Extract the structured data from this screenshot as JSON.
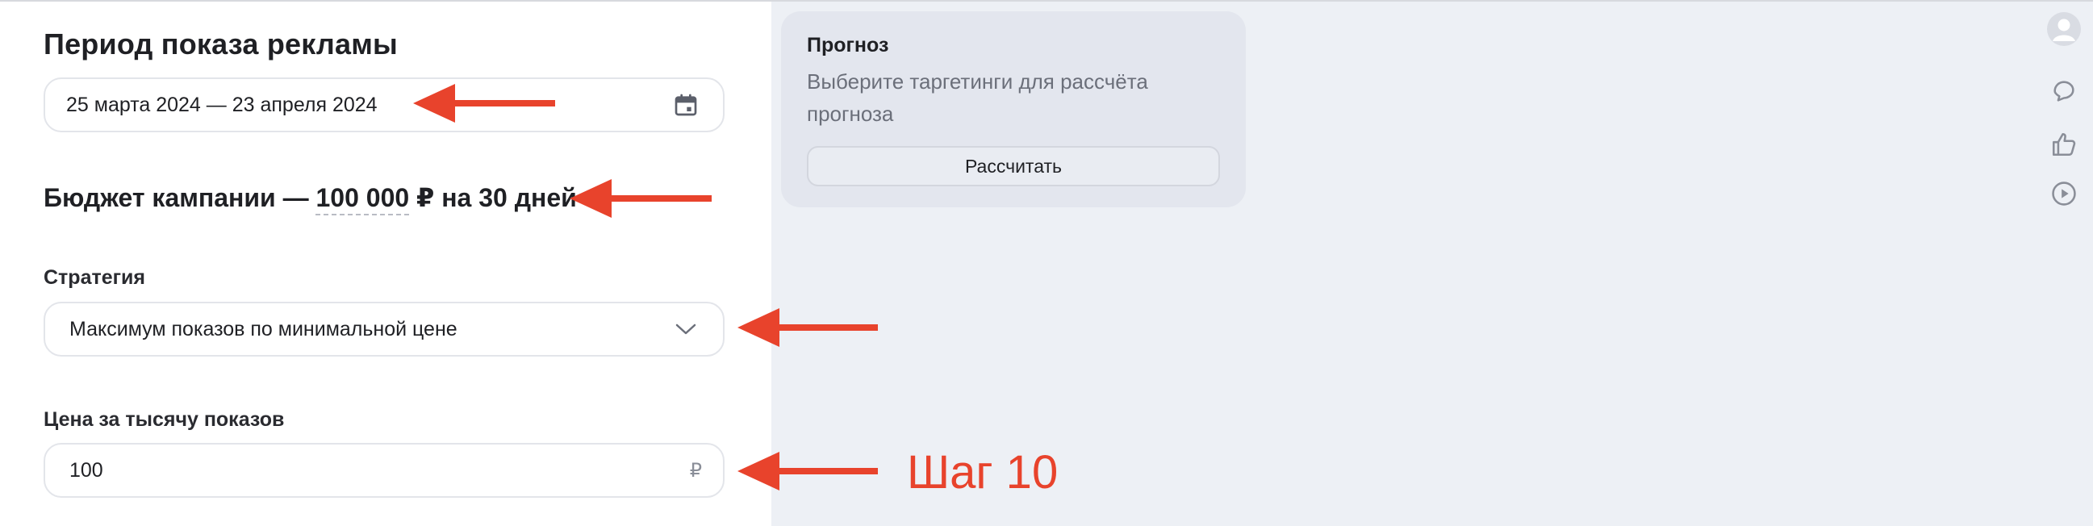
{
  "ad_period": {
    "title": "Период показа рекламы",
    "date_range": "25 марта 2024 — 23 апреля 2024"
  },
  "budget": {
    "prefix": "Бюджет кампании —",
    "amount": "100 000",
    "suffix": "₽ на 30 дней"
  },
  "strategy": {
    "label": "Стратегия",
    "selected": "Максимум показов по минимальной цене"
  },
  "cpm": {
    "label": "Цена за тысячу показов",
    "value": "100",
    "currency": "₽"
  },
  "forecast": {
    "title": "Прогноз",
    "description": "Выберите таргетинги для рассчёта прогноза",
    "button_label": "Рассчитать"
  },
  "annotation": {
    "step_text": "Шаг 10",
    "color": "#e8432c"
  },
  "sidebar_icons": [
    "avatar-icon",
    "chat-icon",
    "thumbs-up-icon",
    "play-icon"
  ]
}
